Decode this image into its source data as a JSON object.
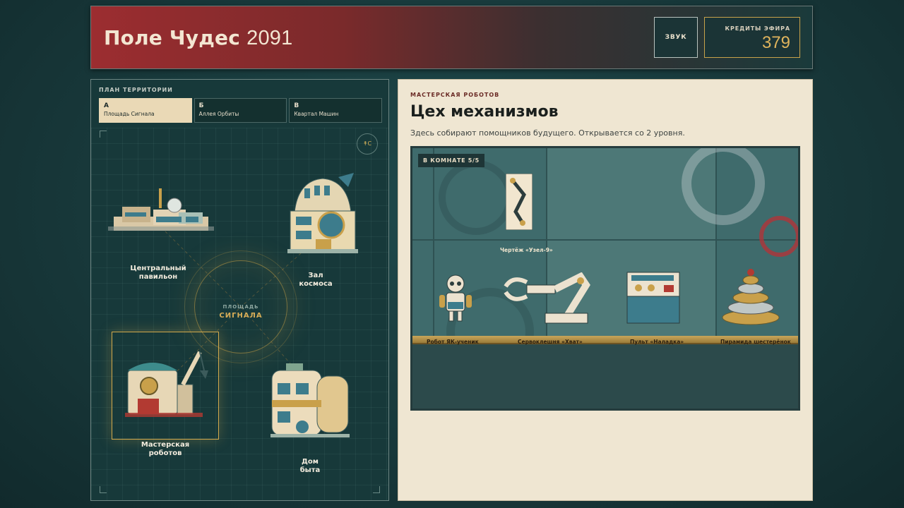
{
  "header": {
    "title_main": "Поле Чудес",
    "title_year": "2091",
    "sound_label": "ЗВУК",
    "credits_label": "КРЕДИТЫ ЭФИРА",
    "credits_value": "379"
  },
  "map": {
    "label": "ПЛАН ТЕРРИТОРИИ",
    "tabs": [
      {
        "key": "А",
        "name": "Площадь Сигнала",
        "active": true
      },
      {
        "key": "Б",
        "name": "Аллея Орбиты",
        "active": false
      },
      {
        "key": "В",
        "name": "Квартал Машин",
        "active": false
      }
    ],
    "compass": "↟С",
    "plaza_small": "ПЛОЩАДЬ",
    "plaza_big": "СИГНАЛА",
    "buildings": [
      {
        "name_line1": "Центральный",
        "name_line2": "павильон"
      },
      {
        "name_line1": "Зал",
        "name_line2": "космоса"
      },
      {
        "name_line1": "Мастерская",
        "name_line2": "роботов"
      },
      {
        "name_line1": "Дом",
        "name_line2": "быта"
      }
    ]
  },
  "detail": {
    "category": "МАСТЕРСКАЯ РОБОТОВ",
    "title": "Цех механизмов",
    "description": "Здесь собирают помощников будущего. Открывается со 2 уровня.",
    "room_badge": "В КОМНАТЕ 5/5",
    "blueprint_label": "Чертёж «Узел-9»",
    "items": [
      "Робот ЯК-ученик",
      "Сервоклешня «Хват»",
      "Пульт «Наладка»",
      "Пирамида шестерёнок"
    ]
  },
  "colors": {
    "accent_gold": "#d8ad57",
    "header_red": "#9c2d30",
    "panel_teal": "#17393a",
    "paper": "#efe6d2"
  }
}
